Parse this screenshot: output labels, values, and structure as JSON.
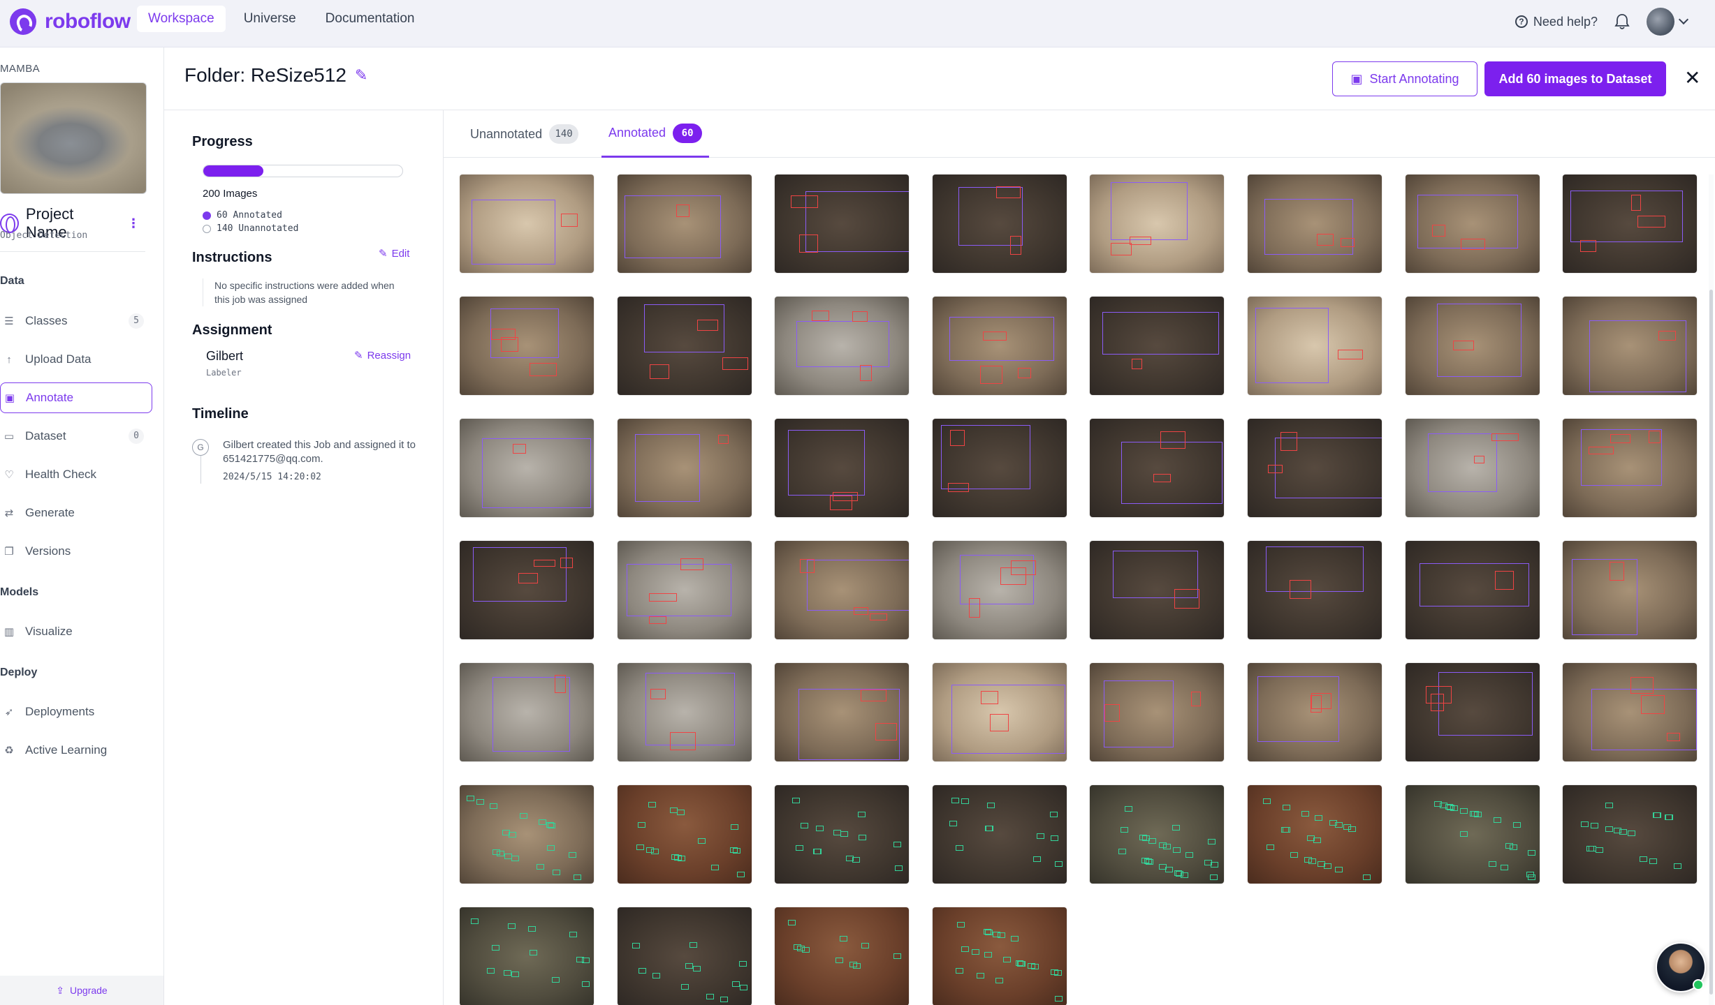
{
  "nav": {
    "brand": "roboflow",
    "links": [
      {
        "label": "Workspace",
        "active": true
      },
      {
        "label": "Universe",
        "active": false
      },
      {
        "label": "Documentation",
        "active": false
      }
    ],
    "help": "Need help?"
  },
  "sidebar": {
    "workspace": "MAMBA",
    "project_name": "Project Name",
    "project_type": "Object Detection",
    "sections": {
      "data": "Data",
      "models": "Models",
      "deploy": "Deploy"
    },
    "items": [
      {
        "label": "Classes",
        "icon": "list-icon",
        "badge": "5"
      },
      {
        "label": "Upload Data",
        "icon": "upload-icon",
        "badge": ""
      },
      {
        "label": "Annotate",
        "icon": "annotate-icon",
        "badge": "",
        "active": true
      },
      {
        "label": "Dataset",
        "icon": "dataset-icon",
        "badge": "0"
      },
      {
        "label": "Health Check",
        "icon": "health-icon",
        "badge": ""
      },
      {
        "label": "Generate",
        "icon": "generate-icon",
        "badge": ""
      },
      {
        "label": "Versions",
        "icon": "versions-icon",
        "badge": ""
      },
      {
        "label": "Visualize",
        "icon": "chart-icon",
        "badge": ""
      },
      {
        "label": "Deployments",
        "icon": "rocket-icon",
        "badge": ""
      },
      {
        "label": "Active Learning",
        "icon": "recycle-icon",
        "badge": ""
      }
    ],
    "upgrade": "Upgrade"
  },
  "header": {
    "folder_title": "Folder: ReSize512",
    "start_annotating": "Start Annotating",
    "add_images": "Add 60 images to Dataset"
  },
  "info": {
    "progress_title": "Progress",
    "progress_fraction": 0.3,
    "total": "200 Images",
    "annotated": "60 Annotated",
    "unannotated": "140 Unannotated",
    "instructions_title": "Instructions",
    "edit": "Edit",
    "instructions_text": "No specific instructions were added when this job was assigned",
    "assignment_title": "Assignment",
    "reassign": "Reassign",
    "assignee": "Gilbert",
    "role": "Labeler",
    "timeline_title": "Timeline",
    "timeline_initial": "G",
    "timeline_text": "Gilbert created this Job and assigned it to 651421775@qq.com.",
    "timeline_time": "2024/5/15 14:20:02"
  },
  "tabs": [
    {
      "label": "Unannotated",
      "count": "140"
    },
    {
      "label": "Annotated",
      "count": "60"
    }
  ],
  "colors": {
    "accent": "#7c20ee",
    "box_purple": "#8b5cf6",
    "box_red": "#ef4444",
    "box_green": "#34d399"
  },
  "thumbnails": [
    "light",
    "mid",
    "dark",
    "dark",
    "light",
    "mid",
    "mid",
    "dark",
    "mid",
    "dark",
    "grey",
    "mid",
    "dark",
    "light",
    "mid",
    "mid",
    "grey",
    "mid",
    "dark",
    "dark",
    "dark",
    "dark",
    "grey",
    "mid",
    "dark",
    "grey",
    "mid",
    "grey",
    "dark",
    "dark",
    "dark",
    "mid",
    "grey",
    "grey",
    "mid",
    "light",
    "mid",
    "mid",
    "dark",
    "mid",
    "mid",
    "red",
    "dark",
    "dark",
    "olive",
    "red",
    "olive",
    "dark",
    "olive",
    "dark",
    "red",
    "red"
  ]
}
